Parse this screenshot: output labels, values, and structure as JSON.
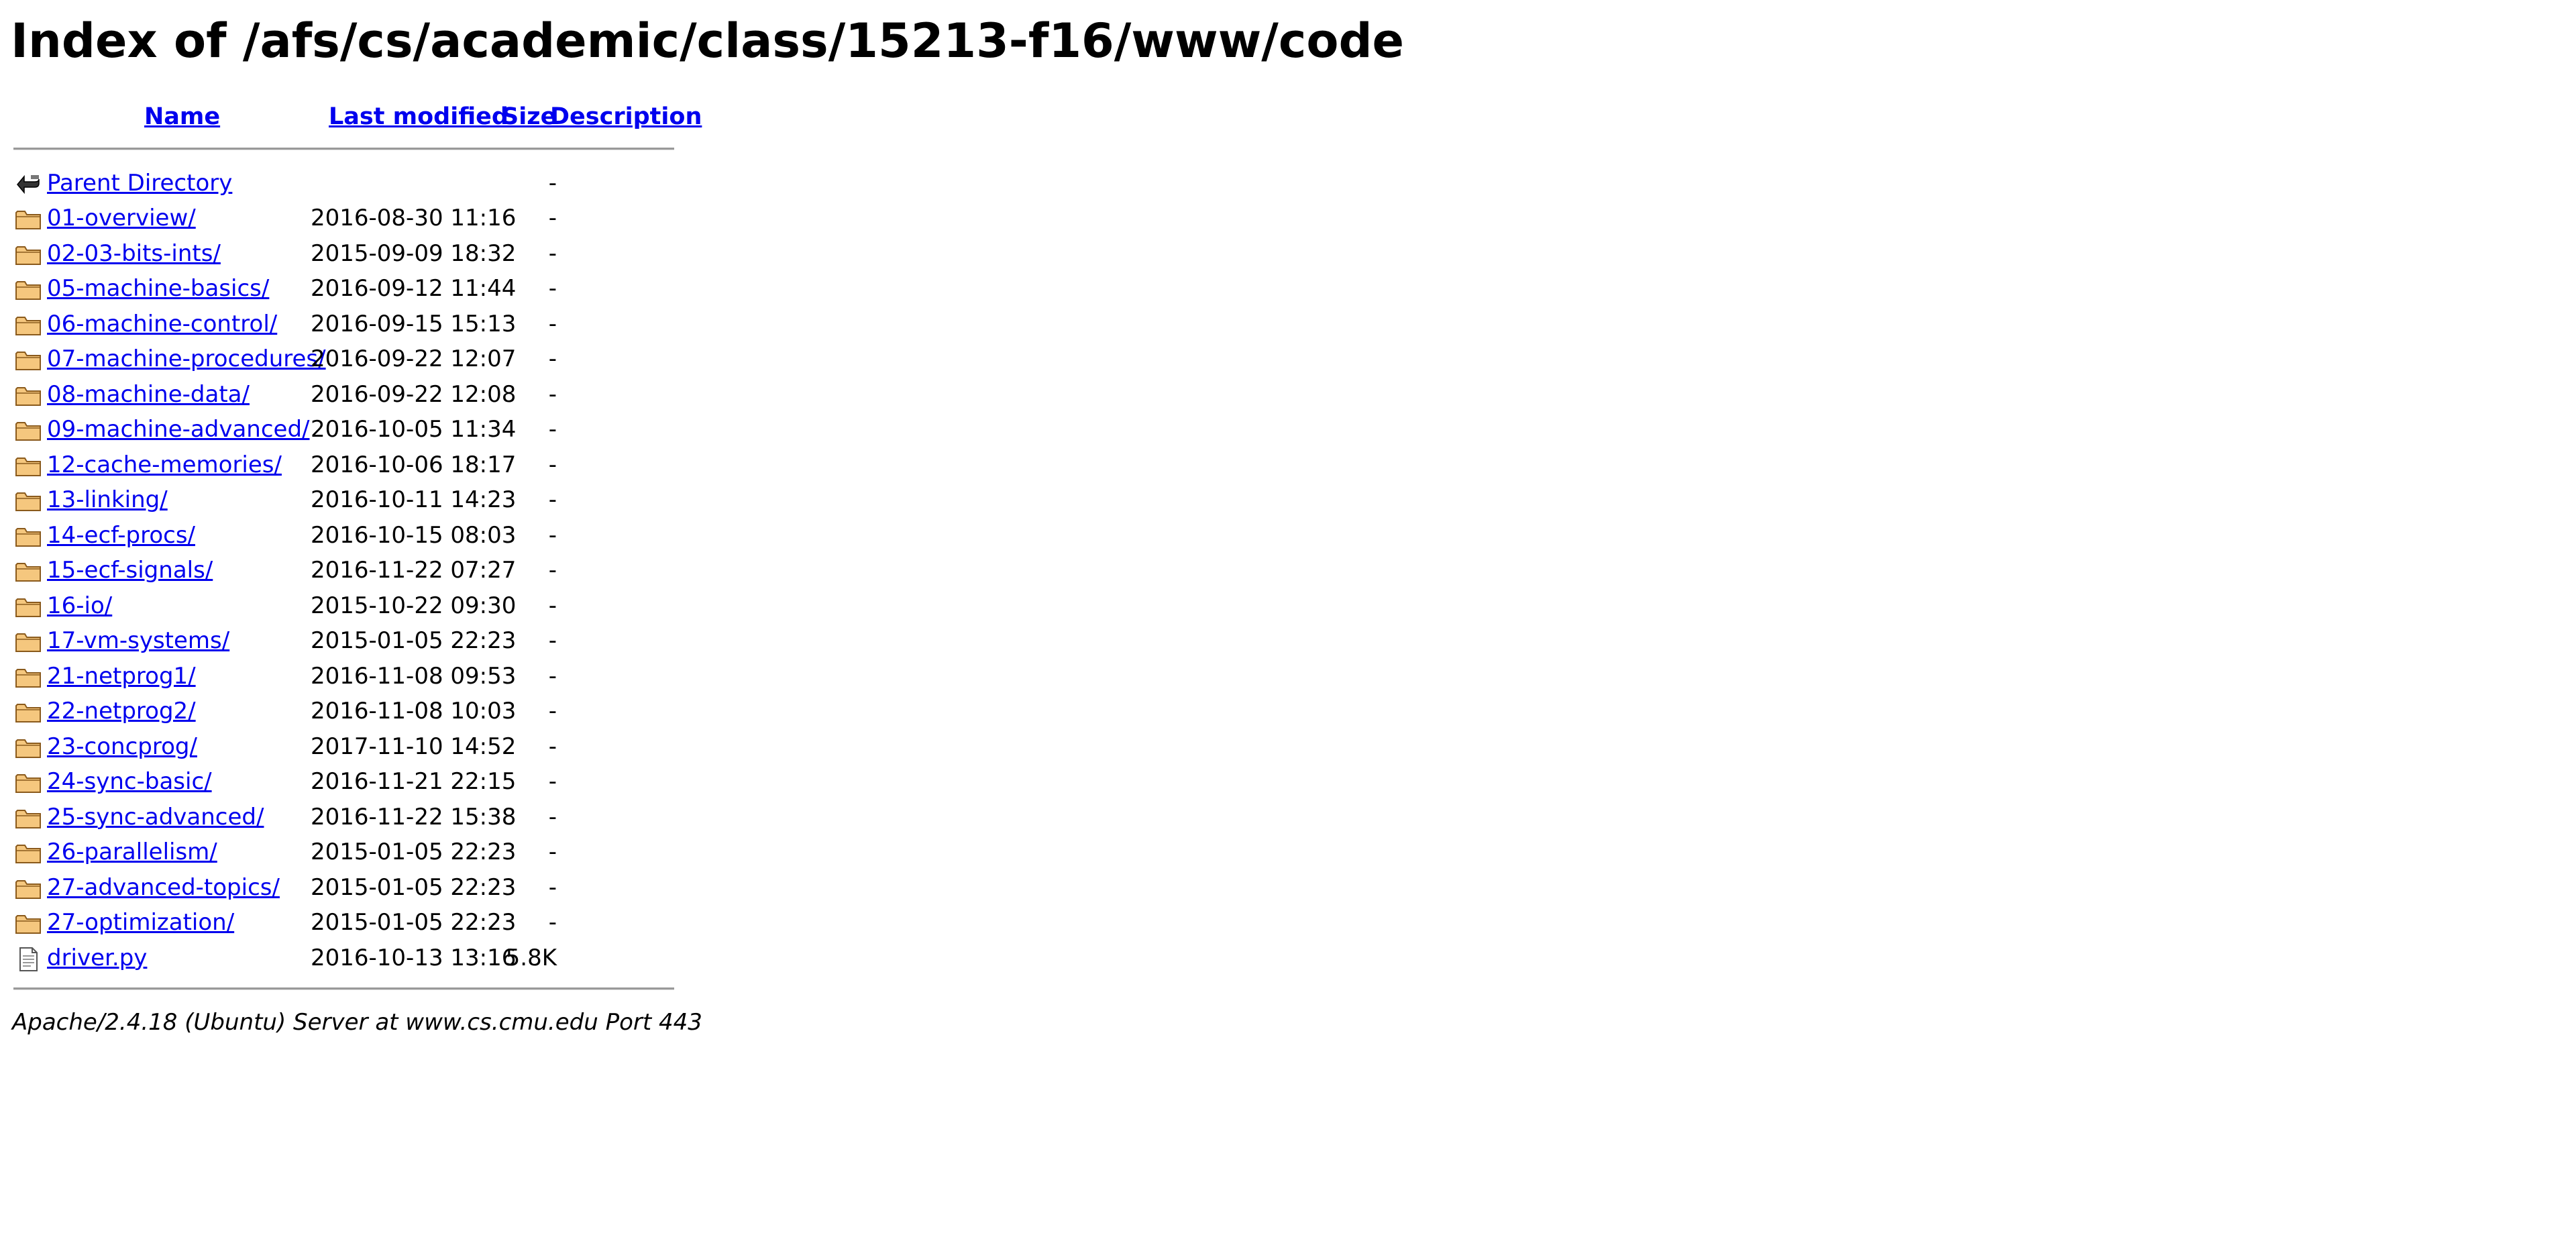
{
  "page": {
    "title": "Index of /afs/cs/academic/class/15213-f16/www/code"
  },
  "columns": {
    "name": "Name",
    "last_modified": "Last modified",
    "size": "Size",
    "description": "Description"
  },
  "parent": {
    "icon": "back-icon",
    "label": "Parent Directory",
    "size": "-"
  },
  "entries": [
    {
      "icon": "folder-icon",
      "name": "01-overview/",
      "modified": "2016-08-30 11:16",
      "size": "-"
    },
    {
      "icon": "folder-icon",
      "name": "02-03-bits-ints/",
      "modified": "2015-09-09 18:32",
      "size": "-"
    },
    {
      "icon": "folder-icon",
      "name": "05-machine-basics/",
      "modified": "2016-09-12 11:44",
      "size": "-"
    },
    {
      "icon": "folder-icon",
      "name": "06-machine-control/",
      "modified": "2016-09-15 15:13",
      "size": "-"
    },
    {
      "icon": "folder-icon",
      "name": "07-machine-procedures/",
      "modified": "2016-09-22 12:07",
      "size": "-"
    },
    {
      "icon": "folder-icon",
      "name": "08-machine-data/",
      "modified": "2016-09-22 12:08",
      "size": "-"
    },
    {
      "icon": "folder-icon",
      "name": "09-machine-advanced/",
      "modified": "2016-10-05 11:34",
      "size": "-"
    },
    {
      "icon": "folder-icon",
      "name": "12-cache-memories/",
      "modified": "2016-10-06 18:17",
      "size": "-"
    },
    {
      "icon": "folder-icon",
      "name": "13-linking/",
      "modified": "2016-10-11 14:23",
      "size": "-"
    },
    {
      "icon": "folder-icon",
      "name": "14-ecf-procs/",
      "modified": "2016-10-15 08:03",
      "size": "-"
    },
    {
      "icon": "folder-icon",
      "name": "15-ecf-signals/",
      "modified": "2016-11-22 07:27",
      "size": "-"
    },
    {
      "icon": "folder-icon",
      "name": "16-io/",
      "modified": "2015-10-22 09:30",
      "size": "-"
    },
    {
      "icon": "folder-icon",
      "name": "17-vm-systems/",
      "modified": "2015-01-05 22:23",
      "size": "-"
    },
    {
      "icon": "folder-icon",
      "name": "21-netprog1/",
      "modified": "2016-11-08 09:53",
      "size": "-"
    },
    {
      "icon": "folder-icon",
      "name": "22-netprog2/",
      "modified": "2016-11-08 10:03",
      "size": "-"
    },
    {
      "icon": "folder-icon",
      "name": "23-concprog/",
      "modified": "2017-11-10 14:52",
      "size": "-"
    },
    {
      "icon": "folder-icon",
      "name": "24-sync-basic/",
      "modified": "2016-11-21 22:15",
      "size": "-"
    },
    {
      "icon": "folder-icon",
      "name": "25-sync-advanced/",
      "modified": "2016-11-22 15:38",
      "size": "-"
    },
    {
      "icon": "folder-icon",
      "name": "26-parallelism/",
      "modified": "2015-01-05 22:23",
      "size": "-"
    },
    {
      "icon": "folder-icon",
      "name": "27-advanced-topics/",
      "modified": "2015-01-05 22:23",
      "size": "-"
    },
    {
      "icon": "folder-icon",
      "name": "27-optimization/",
      "modified": "2015-01-05 22:23",
      "size": "-"
    },
    {
      "icon": "text-file-icon",
      "name": "driver.py",
      "modified": "2016-10-13 13:16",
      "size": "5.8K"
    }
  ],
  "footer": "Apache/2.4.18 (Ubuntu) Server at www.cs.cmu.edu Port 443",
  "colors": {
    "link": "#0000ee",
    "rule": "#999999",
    "folder_fill": "#f5c77e",
    "folder_stroke": "#8a5a1c"
  }
}
